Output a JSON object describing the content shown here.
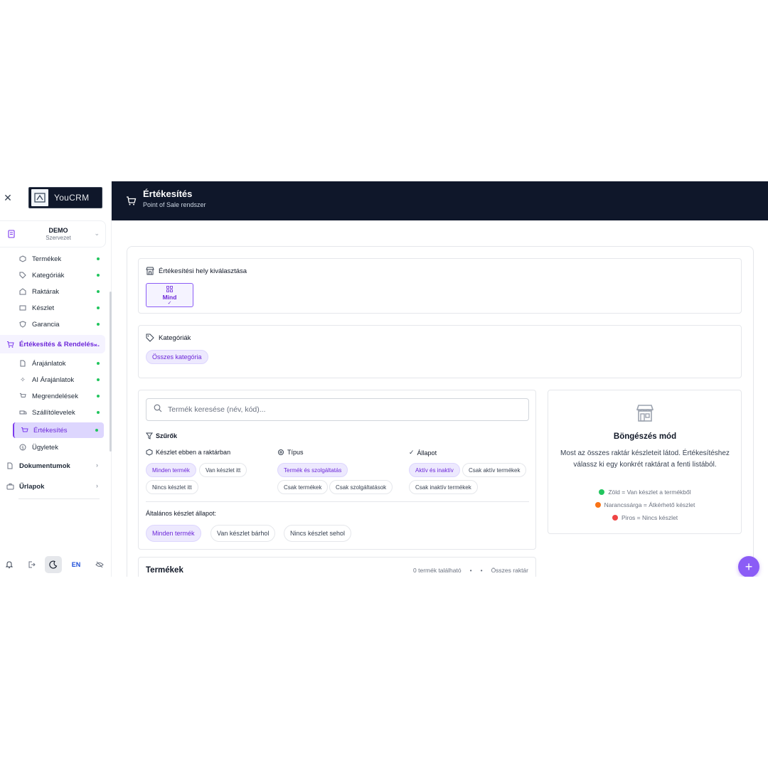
{
  "brand": {
    "name": "YouCRM"
  },
  "org": {
    "name": "DEMO",
    "subtitle": "Szervezet"
  },
  "sidebar": {
    "items_top": [
      {
        "label": "Termékek",
        "icon": "box-icon"
      },
      {
        "label": "Kategóriák",
        "icon": "tag-icon"
      },
      {
        "label": "Raktárak",
        "icon": "warehouse-icon"
      },
      {
        "label": "Készlet",
        "icon": "stack-icon"
      },
      {
        "label": "Garancia",
        "icon": "shield-icon"
      }
    ],
    "group": {
      "label": "Értékesítés & Rendelés...",
      "icon": "cart-icon"
    },
    "group_items": [
      {
        "label": "Árajánlatok",
        "icon": "document-icon"
      },
      {
        "label": "AI Árajánlatok",
        "icon": "sparkle-icon"
      },
      {
        "label": "Megrendelések",
        "icon": "cart-icon"
      },
      {
        "label": "Szállítólevelek",
        "icon": "truck-icon"
      },
      {
        "label": "Értékesítés",
        "icon": "pos-icon"
      },
      {
        "label": "Ügyletek",
        "icon": "dollar-icon"
      }
    ],
    "sections": [
      {
        "label": "Dokumentumok",
        "icon": "folder-icon"
      },
      {
        "label": "Űrlapok",
        "icon": "briefcase-icon"
      }
    ],
    "footer": {
      "language": "EN"
    }
  },
  "header": {
    "title": "Értékesítés",
    "subtitle": "Point of Sale rendszer"
  },
  "location": {
    "title": "Értékesítési hely kiválasztása",
    "option_label": "Mind",
    "option_icon": "grid-icon",
    "check": "✓"
  },
  "categories": {
    "title": "Kategóriák",
    "chip": "Összes kategória"
  },
  "search": {
    "placeholder": "Termék keresése (név, kód)..."
  },
  "filters": {
    "title": "Szűrők",
    "stock": {
      "label": "Készlet ebben a raktárban",
      "options": [
        "Minden termék",
        "Van készlet itt",
        "Nincs készlet itt"
      ]
    },
    "type": {
      "label": "Típus",
      "options": [
        "Termék és szolgáltatás",
        "Csak termékek",
        "Csak szolgáltatások"
      ]
    },
    "status": {
      "label": "Állapot",
      "options": [
        "Aktív és inaktív",
        "Csak aktív termékek",
        "Csak inaktív termékek"
      ]
    },
    "general": {
      "label": "Általános készlet állapot:",
      "options": [
        "Minden termék",
        "Van készlet bárhol",
        "Nincs készlet sehol"
      ]
    }
  },
  "browse": {
    "title": "Böngészés mód",
    "description": "Most az összes raktár készleteit látod. Értékesítéshez válassz ki egy konkrét raktárat a fenti listából.",
    "legend": [
      {
        "text": "Zöld = Van készlet a termékből",
        "color": "#22c55e"
      },
      {
        "text": "Narancssárga = Átkérhető készlet",
        "color": "#f97316"
      },
      {
        "text": "Piros = Nincs készlet",
        "color": "#ef4444"
      }
    ]
  },
  "products": {
    "title": "Termékek",
    "count": "0 termék található",
    "sep1": "•",
    "sep2": "•",
    "scope": "Összes raktár"
  },
  "fab": {
    "label": "+"
  },
  "colors": {
    "accent": "#7c3aed",
    "header_bg": "#0f172a",
    "active_bg": "#ddd6fe"
  }
}
